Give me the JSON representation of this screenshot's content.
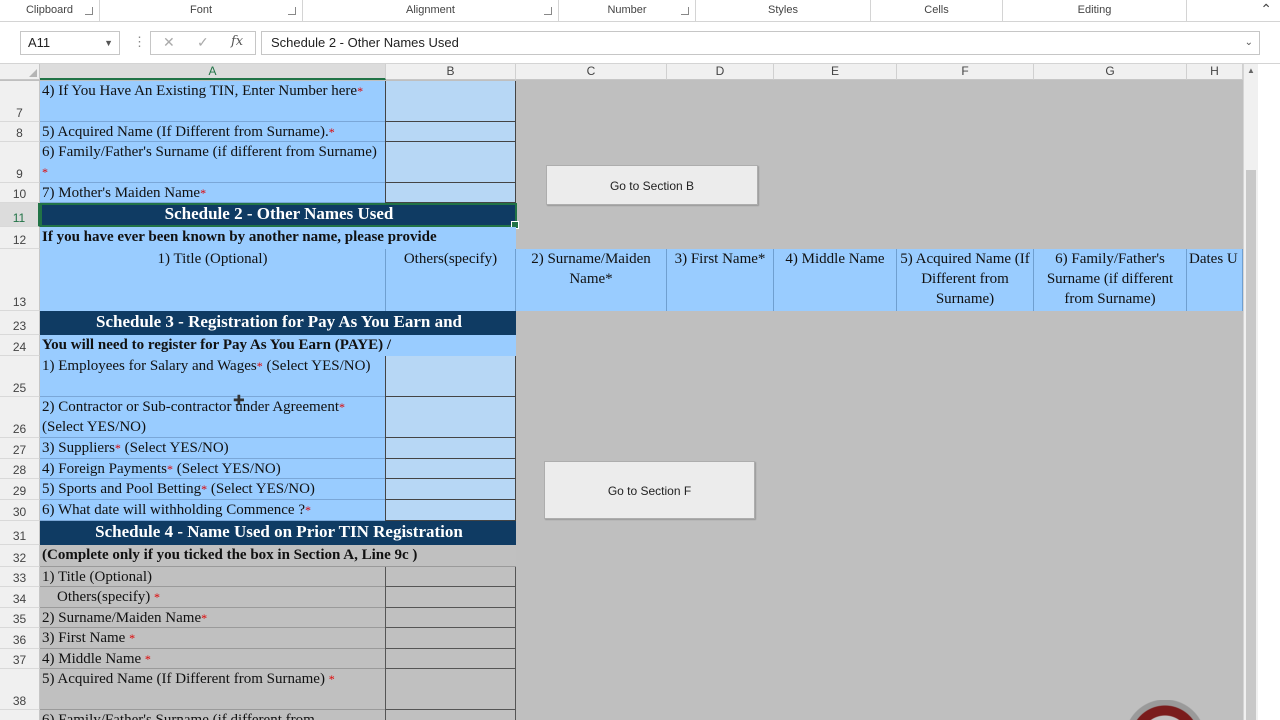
{
  "ribbon": {
    "groups": [
      {
        "label": "Clipboard"
      },
      {
        "label": "Font"
      },
      {
        "label": "Alignment"
      },
      {
        "label": "Number"
      },
      {
        "label": "Styles"
      },
      {
        "label": "Cells"
      },
      {
        "label": "Editing"
      }
    ],
    "collapse_icon": "chevron-up-icon"
  },
  "formula_bar": {
    "name_box": "A11",
    "fx": "fx",
    "content": "Schedule 2 - Other Names Used"
  },
  "columns": [
    "A",
    "B",
    "C",
    "D",
    "E",
    "F",
    "G",
    "H"
  ],
  "rows": {
    "r7": {
      "num": "7",
      "a": "4) If You Have An Existing TIN, Enter Number here"
    },
    "r8": {
      "num": "8",
      "a": "5) Acquired Name (If Different from Surname)."
    },
    "r9": {
      "num": "9",
      "a": "6) Family/Father's Surname (if different from Surname) "
    },
    "r10": {
      "num": "10",
      "a": "7) Mother's Maiden Name"
    },
    "r11": {
      "num": "11",
      "a": "Schedule 2 - Other Names Used"
    },
    "r12": {
      "num": "12",
      "a": "If you have ever been known by another name, please provide"
    },
    "r13": {
      "num": "13",
      "a": "1) Title (Optional)",
      "b": "Others(specify)",
      "c": "2) Surname/Maiden Name*",
      "d": "3) First Name*",
      "e": "4) Middle Name",
      "f": "5) Acquired Name (If Different from Surname)",
      "g": "6) Family/Father's Surname (if different from Surname)",
      "h": "Dates U"
    },
    "r23": {
      "num": "23",
      "a": "Schedule 3 - Registration for Pay As You Earn and"
    },
    "r24": {
      "num": "24",
      "a": "You will need to register for Pay As You Earn (PAYE) /"
    },
    "r25": {
      "num": "25",
      "a": "1) Employees for Salary and Wages",
      "a2": " (Select YES/NO)"
    },
    "r26": {
      "num": "26",
      "a": "2) Contractor or Sub-contractor under Agreement",
      "a2": " (Select YES/NO)"
    },
    "r27": {
      "num": "27",
      "a": "3) Suppliers",
      "a2": " (Select YES/NO)"
    },
    "r28": {
      "num": "28",
      "a": "4) Foreign Payments",
      "a2": " (Select YES/NO)"
    },
    "r29": {
      "num": "29",
      "a": "5) Sports and Pool Betting",
      "a2": " (Select YES/NO)"
    },
    "r30": {
      "num": "30",
      "a": "6) What date will withholding Commence ?"
    },
    "r31": {
      "num": "31",
      "a": "Schedule 4 - Name Used on Prior TIN Registration"
    },
    "r32": {
      "num": "32",
      "a": "(Complete only if you ticked the box in Section A, Line 9c )"
    },
    "r33": {
      "num": "33",
      "a": "1) Title (Optional)"
    },
    "r34": {
      "num": "34",
      "a": "Others(specify) "
    },
    "r35": {
      "num": "35",
      "a": "2) Surname/Maiden Name"
    },
    "r36": {
      "num": "36",
      "a": "3) First Name "
    },
    "r37": {
      "num": "37",
      "a": "4) Middle Name "
    },
    "r38": {
      "num": "38",
      "a": "5) Acquired Name (If Different from Surname)  "
    },
    "r39": {
      "a": "6) Family/Father's Surname (if different from"
    }
  },
  "required_mark": "*",
  "buttons": {
    "section_b": "Go to Section B",
    "section_f": "Go to Section F"
  }
}
